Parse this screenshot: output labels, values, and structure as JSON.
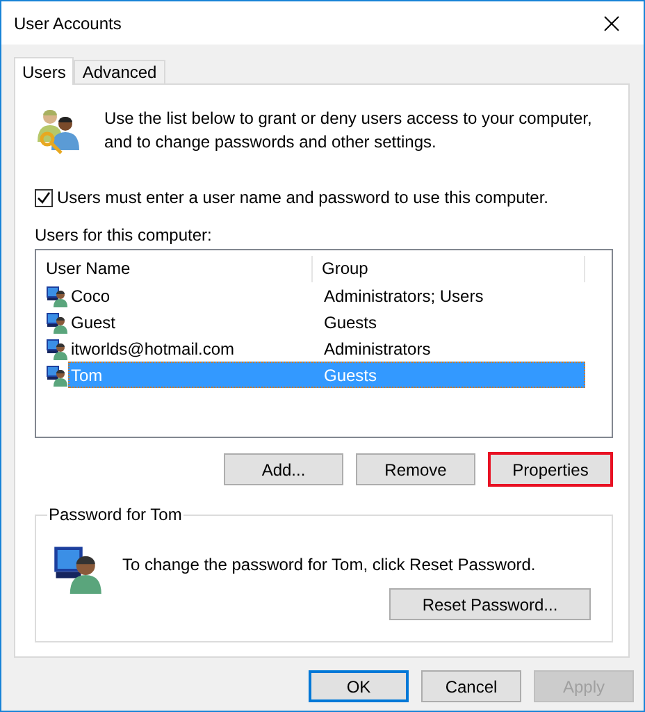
{
  "window": {
    "title": "User Accounts"
  },
  "tabs": [
    {
      "label": "Users",
      "selected": true
    },
    {
      "label": "Advanced",
      "selected": false
    }
  ],
  "intro": "Use the list below to grant or deny users access to your computer, and to change passwords and other settings.",
  "require_password": {
    "label": "Users must enter a user name and password to use this computer.",
    "checked": true
  },
  "users_label": "Users for this computer:",
  "table": {
    "columns": [
      "User Name",
      "Group"
    ],
    "rows": [
      {
        "user_name": "Coco",
        "group": "Administrators; Users",
        "selected": false
      },
      {
        "user_name": "Guest",
        "group": "Guests",
        "selected": false
      },
      {
        "user_name": "itworlds@hotmail.com",
        "group": "Administrators",
        "selected": false
      },
      {
        "user_name": "Tom",
        "group": "Guests",
        "selected": true
      }
    ]
  },
  "actions": [
    {
      "label": "Add...",
      "highlighted": false
    },
    {
      "label": "Remove",
      "highlighted": false
    },
    {
      "label": "Properties",
      "highlighted": true
    }
  ],
  "password_group": {
    "title": "Password for Tom",
    "message": "To change the password for Tom, click Reset Password.",
    "button": "Reset Password..."
  },
  "footer_buttons": [
    {
      "label": "OK",
      "default": true,
      "disabled": false
    },
    {
      "label": "Cancel",
      "default": false,
      "disabled": false
    },
    {
      "label": "Apply",
      "default": false,
      "disabled": true
    }
  ]
}
